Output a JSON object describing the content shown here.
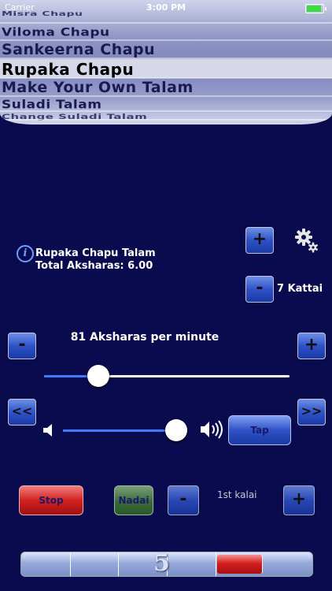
{
  "status_bar": {
    "carrier": "Carrier",
    "time": "3:00 PM"
  },
  "picker": {
    "items": [
      "Misra Chapu",
      "Viloma Chapu",
      "Sankeerna Chapu",
      "Rupaka Chapu",
      "Make Your Own Talam",
      "Suladi Talam",
      "Change Suladi Talam"
    ],
    "selected_index": 3
  },
  "info": {
    "talam_name": "Rupaka Chapu Talam",
    "total_aksharas": "Total Aksharas: 6.00"
  },
  "kattai": {
    "plus": "+",
    "minus": "-",
    "label": "7 Kattai"
  },
  "tempo": {
    "minus": "-",
    "plus": "+",
    "label": "81 Aksharas per minute",
    "slider_fraction": 0.22
  },
  "nav": {
    "prev": "<<",
    "next": ">>"
  },
  "volume": {
    "level_fraction": 0.97,
    "tap_label": "Tap"
  },
  "controls": {
    "stop_label": "Stop",
    "nadai_label": "Nadai",
    "minus": "-",
    "plus": "+",
    "kalai_label": "1st kalai"
  },
  "beats": {
    "current": "5",
    "count": 6,
    "active_index": 4
  },
  "colors": {
    "background": "#0a0a4e",
    "accent_blue": "#2f52c8",
    "stop_red": "#d42020",
    "nadai_green": "#3a6a3a"
  }
}
